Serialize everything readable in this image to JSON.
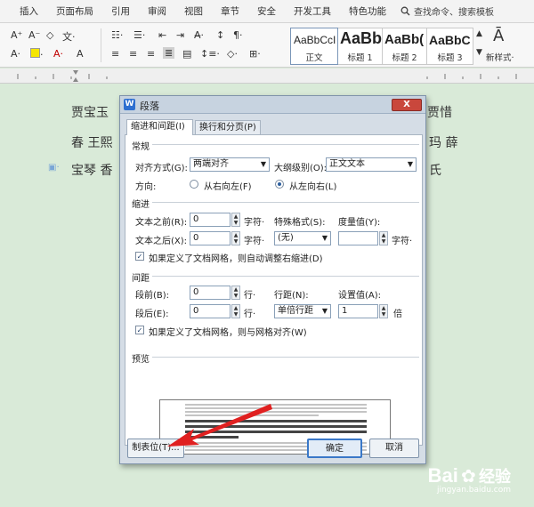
{
  "menu": {
    "items": [
      "插入",
      "页面布局",
      "引用",
      "审阅",
      "视图",
      "章节",
      "安全",
      "开发工具",
      "特色功能"
    ],
    "search_label": "查找命令、搜索模板"
  },
  "ribbon": {
    "styles": [
      {
        "preview": "AaBbCcI",
        "label": "正文"
      },
      {
        "preview": "AaBb",
        "label": "标题 1"
      },
      {
        "preview": "AaBb(",
        "label": "标题 2"
      },
      {
        "preview": "AaBbC",
        "label": "标题 3"
      }
    ],
    "new_style_label": "新样式·"
  },
  "document": {
    "line1_left": "贾宝玉",
    "line1_right": "贾惜",
    "line2_left": "春 王熙",
    "line2_right": "玛 薛",
    "line3_left": "宝琴 香",
    "line3_right": "氏"
  },
  "dialog": {
    "title": "段落",
    "close_label": "X",
    "tabs": [
      "缩进和间距(I)",
      "换行和分页(P)"
    ],
    "general": {
      "section": "常规",
      "align_label": "对齐方式(G):",
      "align_value": "两端对齐",
      "outline_label": "大纲级别(O):",
      "outline_value": "正文文本",
      "direction_label": "方向:",
      "rtl_label": "从右向左(F)",
      "ltr_label": "从左向右(L)"
    },
    "indent": {
      "section": "缩进",
      "before_label": "文本之前(R):",
      "before_value": "0",
      "before_unit": "字符·",
      "after_label": "文本之后(X):",
      "after_value": "0",
      "after_unit": "字符·",
      "special_label": "特殊格式(S):",
      "special_value": "(无)",
      "measure_label": "度量值(Y):",
      "measure_value": "",
      "measure_unit": "字符·",
      "grid_checkbox_label": "如果定义了文档网格，则自动调整右缩进(D)"
    },
    "spacing": {
      "section": "间距",
      "before_label": "段前(B):",
      "before_value": "0",
      "before_unit": "行·",
      "after_label": "段后(E):",
      "after_value": "0",
      "after_unit": "行·",
      "line_label": "行距(N):",
      "line_value": "单倍行距",
      "setting_label": "设置值(A):",
      "setting_value": "1",
      "setting_unit": "倍",
      "grid_checkbox_label": "如果定义了文档网格，则与网格对齐(W)"
    },
    "preview": {
      "section": "预览"
    },
    "buttons": {
      "tabs": "制表位(T)...",
      "ok": "确定",
      "cancel": "取消"
    }
  },
  "watermark": {
    "brand": "Bai",
    "brand_cn": "经验",
    "url": "jingyan.baidu.com"
  },
  "colors": {
    "doc_background": "#d9ead8",
    "arrow": "#e02020",
    "accent": "#3a78c8"
  }
}
